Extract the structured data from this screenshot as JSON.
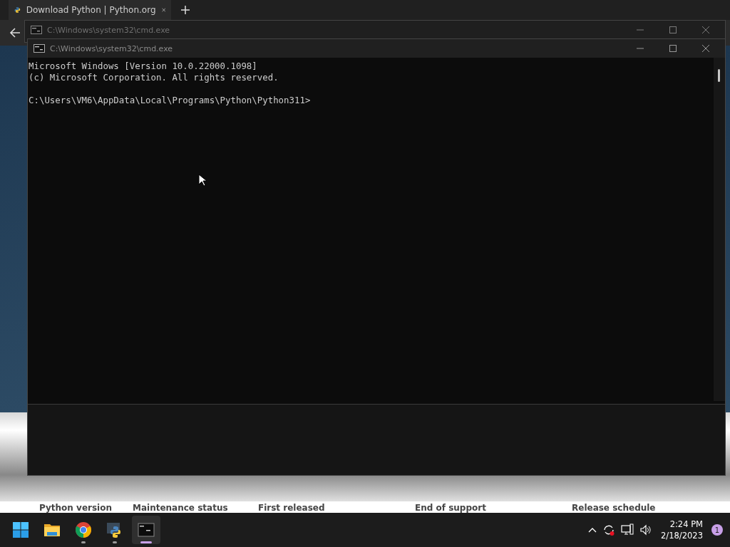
{
  "browser": {
    "tab": {
      "title": "Download Python | Python.org",
      "selected": true
    },
    "table_headers": [
      "Python version",
      "Maintenance status",
      "First released",
      "End of support",
      "Release schedule"
    ]
  },
  "windows": [
    {
      "title": "C:\\Windows\\system32\\cmd.exe",
      "active": false
    },
    {
      "title": "C:\\Windows\\system32\\cmd.exe",
      "active": true,
      "blocks": [
        [
          "Microsoft Windows [Version 10.0.22000.1098]",
          "(c) Microsoft Corporation. All rights reserved."
        ],
        [
          "C:\\Users\\VM6\\AppData\\Local\\Programs\\Python\\Python311>"
        ]
      ]
    }
  ],
  "taskbar": {
    "apps": [
      {
        "kind": "start",
        "running": false,
        "active": false
      },
      {
        "kind": "explorer",
        "running": false,
        "active": false
      },
      {
        "kind": "chrome",
        "running": true,
        "active": false
      },
      {
        "kind": "python",
        "running": true,
        "active": false
      },
      {
        "kind": "terminal",
        "running": true,
        "active": true
      }
    ],
    "time": "2:24 PM",
    "date": "2/18/2023",
    "notifications": "1"
  }
}
